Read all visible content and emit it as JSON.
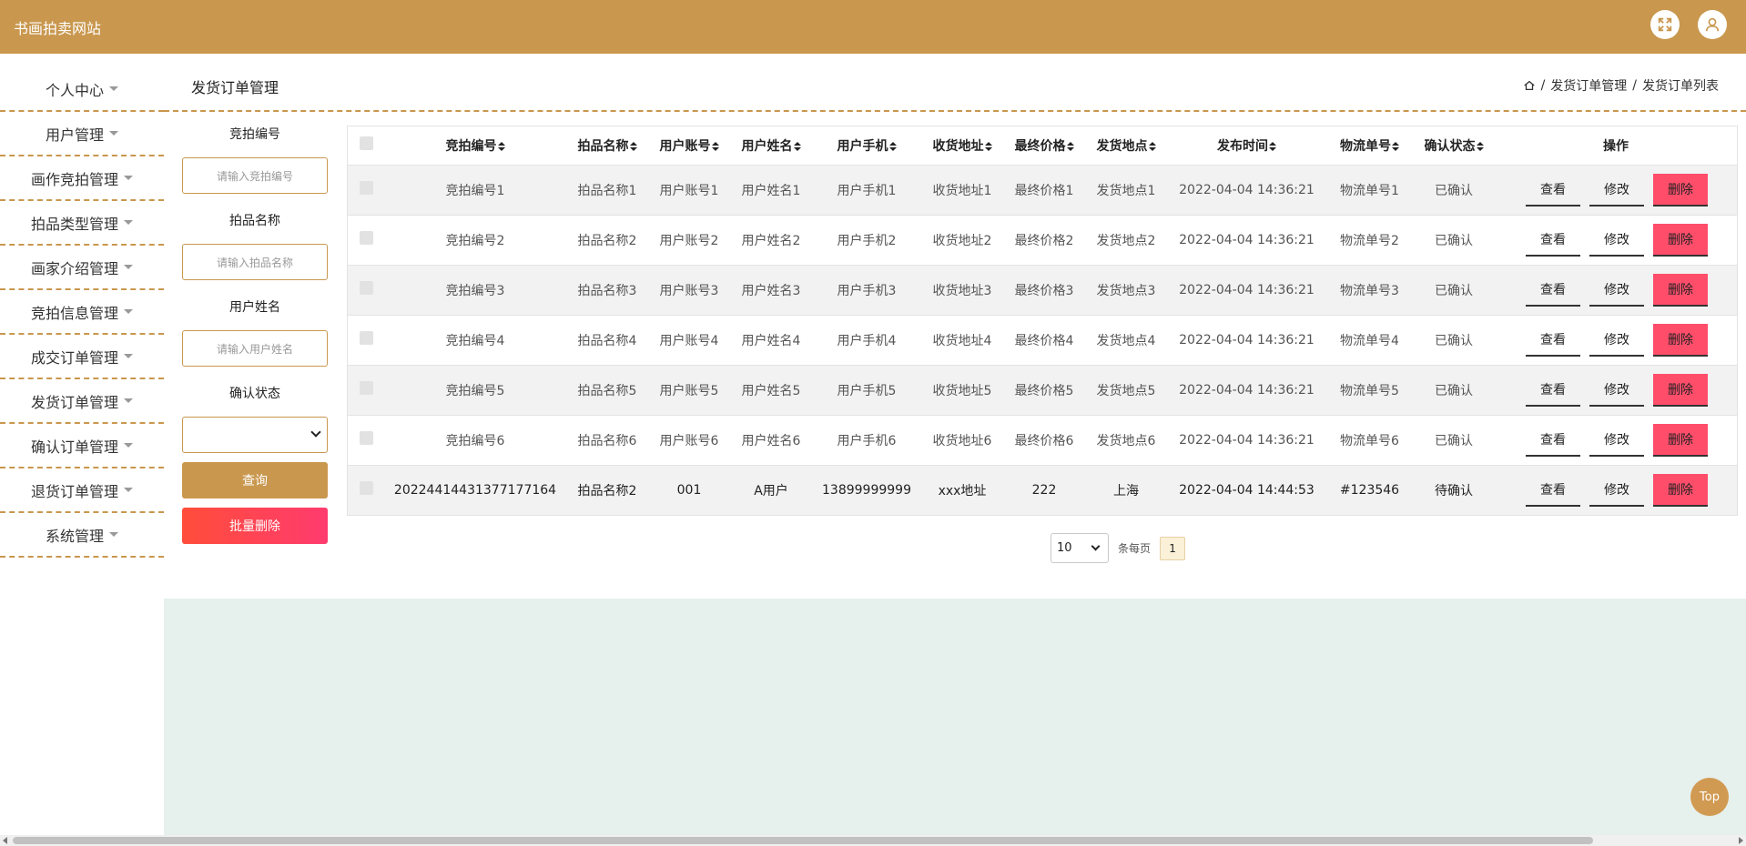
{
  "header": {
    "site_title": "书画拍卖网站",
    "icons": [
      "fullscreen-icon",
      "user-icon"
    ],
    "bg_color": "#c9974e"
  },
  "sidebar": {
    "items": [
      {
        "label": "个人中心"
      },
      {
        "label": "用户管理"
      },
      {
        "label": "画作竞拍管理"
      },
      {
        "label": "拍品类型管理"
      },
      {
        "label": "画家介绍管理"
      },
      {
        "label": "竞拍信息管理"
      },
      {
        "label": "成交订单管理"
      },
      {
        "label": "发货订单管理"
      },
      {
        "label": "确认订单管理"
      },
      {
        "label": "退货订单管理"
      },
      {
        "label": "系统管理"
      }
    ]
  },
  "page": {
    "title": "发货订单管理",
    "breadcrumb": [
      "发货订单管理",
      "发货订单列表"
    ],
    "breadcrumb_sep": "/"
  },
  "search": {
    "f1_label": "竞拍编号",
    "f1_placeholder": "请输入竞拍编号",
    "f2_label": "拍品名称",
    "f2_placeholder": "请输入拍品名称",
    "f3_label": "用户姓名",
    "f3_placeholder": "请输入用户姓名",
    "f4_label": "确认状态",
    "f4_value": "",
    "query_label": "查询",
    "batch_delete_label": "批量删除"
  },
  "table": {
    "headers": [
      "竞拍编号",
      "拍品名称",
      "用户账号",
      "用户姓名",
      "用户手机",
      "收货地址",
      "最终价格",
      "发货地点",
      "发布时间",
      "物流单号",
      "确认状态",
      "操作"
    ],
    "sortable": [
      true,
      true,
      true,
      true,
      true,
      true,
      true,
      true,
      true,
      true,
      true,
      false
    ],
    "rows": [
      [
        "竞拍编号1",
        "拍品名称1",
        "用户账号1",
        "用户姓名1",
        "用户手机1",
        "收货地址1",
        "最终价格1",
        "发货地点1",
        "2022-04-04 14:36:21",
        "物流单号1",
        "已确认"
      ],
      [
        "竞拍编号2",
        "拍品名称2",
        "用户账号2",
        "用户姓名2",
        "用户手机2",
        "收货地址2",
        "最终价格2",
        "发货地点2",
        "2022-04-04 14:36:21",
        "物流单号2",
        "已确认"
      ],
      [
        "竞拍编号3",
        "拍品名称3",
        "用户账号3",
        "用户姓名3",
        "用户手机3",
        "收货地址3",
        "最终价格3",
        "发货地点3",
        "2022-04-04 14:36:21",
        "物流单号3",
        "已确认"
      ],
      [
        "竞拍编号4",
        "拍品名称4",
        "用户账号4",
        "用户姓名4",
        "用户手机4",
        "收货地址4",
        "最终价格4",
        "发货地点4",
        "2022-04-04 14:36:21",
        "物流单号4",
        "已确认"
      ],
      [
        "竞拍编号5",
        "拍品名称5",
        "用户账号5",
        "用户姓名5",
        "用户手机5",
        "收货地址5",
        "最终价格5",
        "发货地点5",
        "2022-04-04 14:36:21",
        "物流单号5",
        "已确认"
      ],
      [
        "竞拍编号6",
        "拍品名称6",
        "用户账号6",
        "用户姓名6",
        "用户手机6",
        "收货地址6",
        "最终价格6",
        "发货地点6",
        "2022-04-04 14:36:21",
        "物流单号6",
        "已确认"
      ],
      [
        "20224414431377177164",
        "拍品名称2",
        "001",
        "A用户",
        "13899999999",
        "xxx地址",
        "222",
        "上海",
        "2022-04-04 14:44:53",
        "#123546",
        "待确认"
      ]
    ],
    "actions": {
      "view": "查看",
      "edit": "修改",
      "delete": "删除"
    }
  },
  "pagination": {
    "page_size": "10",
    "per_page_label": "条每页",
    "current_page": "1"
  },
  "back_to_top": "Top",
  "colors": {
    "accent": "#c9974e",
    "danger": "#ff4d6a",
    "footer_bg": "#e6f0ec"
  }
}
